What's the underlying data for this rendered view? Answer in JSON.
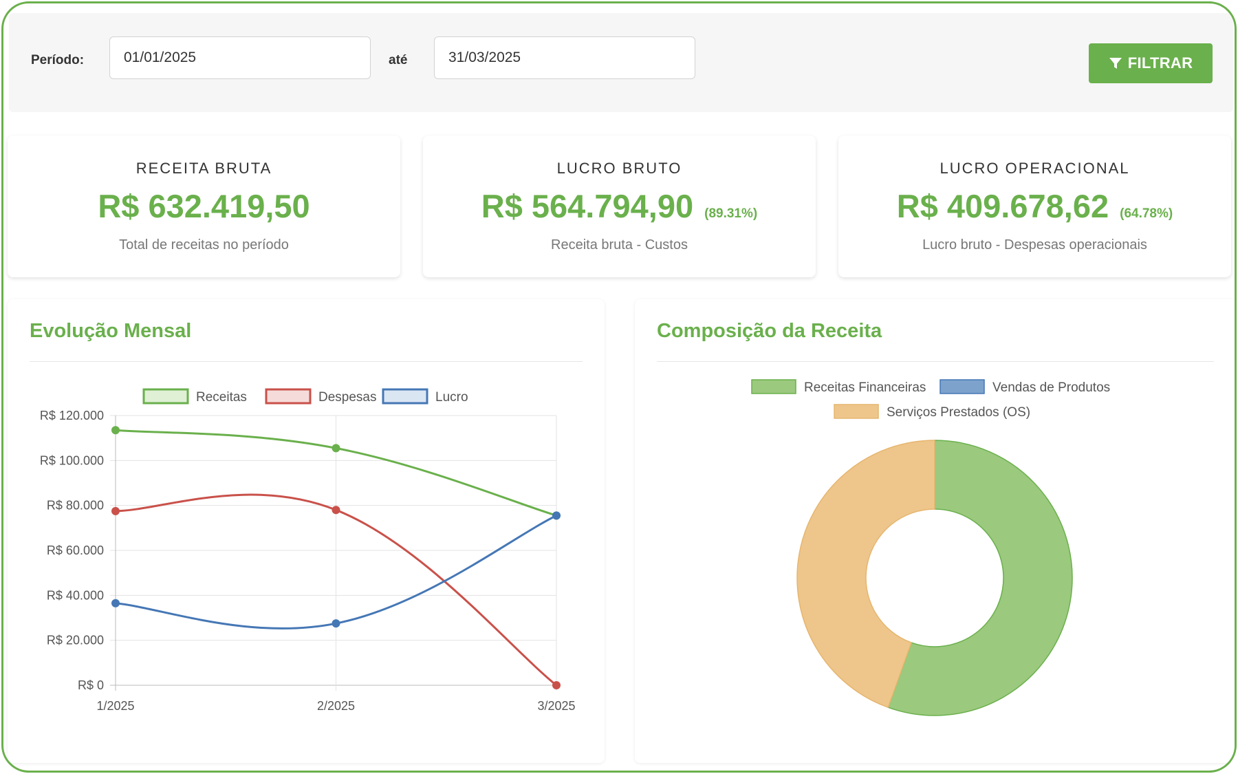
{
  "filter": {
    "period_label": "Período:",
    "start_date": "01/01/2025",
    "until_label": "até",
    "end_date": "31/03/2025",
    "button_label": "FILTRAR"
  },
  "cards": [
    {
      "title": "RECEITA BRUTA",
      "value": "R$ 632.419,50",
      "percent": "",
      "description": "Total de receitas no período"
    },
    {
      "title": "LUCRO BRUTO",
      "value": "R$ 564.794,90",
      "percent": "(89.31%)",
      "description": "Receita bruta - Custos"
    },
    {
      "title": "LUCRO OPERACIONAL",
      "value": "R$ 409.678,62",
      "percent": "(64.78%)",
      "description": "Lucro bruto - Despesas operacionais"
    }
  ],
  "panels": {
    "line_title": "Evolução Mensal",
    "donut_title": "Composição da Receita"
  },
  "colors": {
    "green": "#6ab04c",
    "red": "#c9514a",
    "blue": "#4577b5",
    "orange": "#eec68b",
    "light_green": "#9bc97e",
    "light_blue": "#7da2cc"
  },
  "chart_data": [
    {
      "type": "line",
      "title": "Evolução Mensal",
      "categories": [
        "1/2025",
        "2/2025",
        "3/2025"
      ],
      "series": [
        {
          "name": "Receitas",
          "values": [
            113500,
            105500,
            75500
          ]
        },
        {
          "name": "Despesas",
          "values": [
            77500,
            78000,
            0
          ]
        },
        {
          "name": "Lucro",
          "values": [
            36500,
            27500,
            75500
          ]
        }
      ],
      "yticks": [
        "R$ 120.000",
        "R$ 100.000",
        "R$ 80.000",
        "R$ 60.000",
        "R$ 40.000",
        "R$ 20.000",
        "R$ 0"
      ],
      "ylim": [
        0,
        120000
      ],
      "grid": true,
      "legend": "top"
    },
    {
      "type": "pie",
      "title": "Composição da Receita",
      "labels": [
        "Receitas Financeiras",
        "Vendas de Produtos",
        "Serviços Prestados (OS)"
      ],
      "values": [
        55.5,
        0,
        44.5
      ],
      "legend": "top"
    }
  ]
}
